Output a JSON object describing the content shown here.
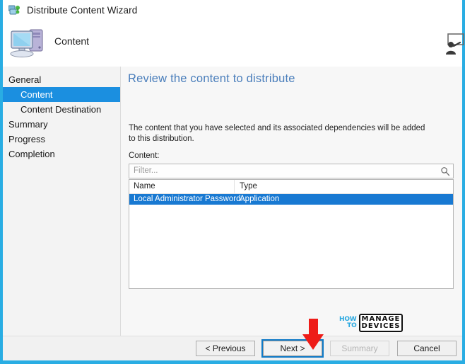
{
  "window": {
    "title": "Distribute Content Wizard",
    "title_icon": "distribute-content-icon",
    "frame_color": "#29ade3"
  },
  "header": {
    "icon": "computer-icon",
    "title": "Content",
    "help_icon": "presenter-help-icon"
  },
  "sidebar": {
    "items": [
      {
        "label": "General",
        "level": "group",
        "selected": false
      },
      {
        "label": "Content",
        "level": "child",
        "selected": true
      },
      {
        "label": "Content Destination",
        "level": "child",
        "selected": false
      },
      {
        "label": "Summary",
        "level": "group",
        "selected": false
      },
      {
        "label": "Progress",
        "level": "group",
        "selected": false
      },
      {
        "label": "Completion",
        "level": "group",
        "selected": false
      }
    ],
    "selected_color": "#1b8fe0"
  },
  "main": {
    "heading": "Review the content to distribute",
    "heading_color": "#4a7ebb",
    "description": "The content that you have selected and its associated dependencies will be added to this distribution.",
    "content_label": "Content:",
    "filter": {
      "placeholder": "Filter...",
      "value": "",
      "icon": "search-icon"
    },
    "table": {
      "columns": [
        "Name",
        "Type"
      ],
      "rows": [
        {
          "name": "Local Administrator Password...",
          "type": "Application",
          "selected": true
        }
      ],
      "selection_color": "#1879d2"
    }
  },
  "watermark": {
    "line1": "HOW",
    "line2": "TO",
    "line3": "MANAGE",
    "line4": "DEVICES",
    "accent_color": "#29a8e0"
  },
  "footer": {
    "buttons": [
      {
        "label": "< Previous",
        "state": "enabled"
      },
      {
        "label": "Next >",
        "state": "focused"
      },
      {
        "label": "Summary",
        "state": "disabled"
      },
      {
        "label": "Cancel",
        "state": "enabled"
      }
    ]
  },
  "annotation": {
    "arrow": "red-down-arrow",
    "color": "#ee1c18",
    "points_at": "Next >"
  }
}
